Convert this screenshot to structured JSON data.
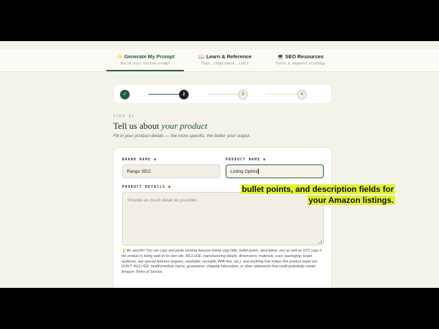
{
  "nav": {
    "tabs": [
      {
        "icon": "✨",
        "label": "Generate My Prompt",
        "sub": "Build your custom prompt",
        "active": true
      },
      {
        "icon": "📖",
        "label": "Learn & Reference",
        "sub": "Tips, compliance, tools",
        "active": false
      },
      {
        "icon": "💻",
        "label": "SEO Resources",
        "sub": "Tools & keyword strategy",
        "active": false
      }
    ]
  },
  "stepper": {
    "steps": [
      {
        "label": "✓",
        "state": "done"
      },
      {
        "label": "2",
        "state": "current"
      },
      {
        "label": "3",
        "state": "todo"
      },
      {
        "label": "4",
        "state": "todo"
      }
    ]
  },
  "step": {
    "eyebrow": "STEP 02",
    "title_prefix": "Tell us about ",
    "title_emph": "your product",
    "subtitle": "Fill in your product details — the more specific, the better your output."
  },
  "form": {
    "brand_label": "BRAND NAME",
    "brand_value": "Rango SEO",
    "product_label": "PRODUCT NAME",
    "product_value": "Listing Optimi",
    "details_label": "PRODUCT DETAILS",
    "details_placeholder": "Provide as much detail as possible.",
    "required_mark": "●",
    "help_icon": "💡",
    "help_text": "Be specific! You can copy and paste existing Amazon listing copy (title, bullet points, description, etc) as well as DTC copy if the product is being sold on its own site. INCLUDE: manufacturing details, dimensions, materials, uses, packaging, target audience, any special features (organic, washable, reusable, BPA-free, etc.), and anything that makes this product stand out. DON'T INCLUDE: health/medical claims, guarantees, shipping information, or other statements that could potentially violate Amazon Terms of Service."
  },
  "caption": {
    "line1": "bullet points, and description fields for",
    "line2": "your Amazon listings."
  },
  "colors": {
    "accent": "#215c3d",
    "required": "#b8323a",
    "caption_highlight": "#dff232"
  }
}
